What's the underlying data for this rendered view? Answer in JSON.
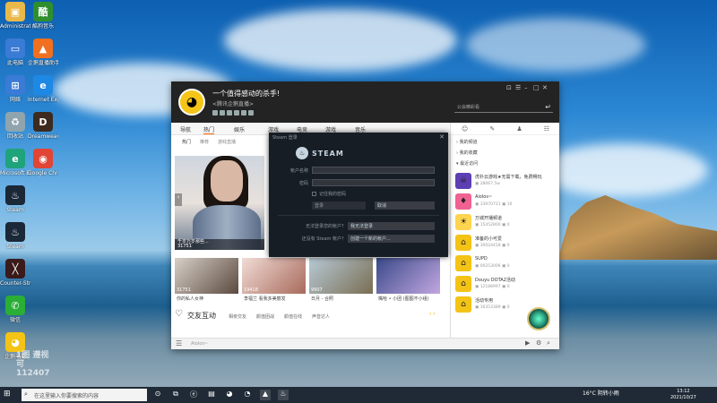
{
  "desktop": {
    "icons": [
      {
        "label": "Administrator",
        "icon": "user-folder-icon",
        "color": "#e8b84a",
        "glyph": "▣"
      },
      {
        "label": "酷狗音乐",
        "icon": "kugou-icon",
        "color": "#2f8f2f",
        "glyph": "酷"
      },
      {
        "label": "此电脑",
        "icon": "computer-icon",
        "color": "#3a7bd5",
        "glyph": "▭"
      },
      {
        "label": "企鹅直播助手",
        "icon": "live-assistant-icon",
        "color": "#f07020",
        "glyph": "▲"
      },
      {
        "label": "网络",
        "icon": "network-icon",
        "color": "#3a7bd5",
        "glyph": "⊞"
      },
      {
        "label": "Internet Explorer",
        "icon": "ie-icon",
        "color": "#1e88e5",
        "glyph": "e"
      },
      {
        "label": "回收站",
        "icon": "recycle-bin-icon",
        "color": "#90a4ae",
        "glyph": "♻"
      },
      {
        "label": "Dreamweaver Illustrator",
        "icon": "dreamweaver-icon",
        "color": "#3d2b1f",
        "glyph": "D"
      },
      {
        "label": "Microsoft Edge",
        "icon": "edge-icon",
        "color": "#1fa37a",
        "glyph": "e"
      },
      {
        "label": "Google Chrome",
        "icon": "chrome-icon",
        "color": "#e04535",
        "glyph": "◉"
      },
      {
        "label": "Steam",
        "icon": "steam-icon",
        "color": "#1b2838",
        "glyph": "♨"
      },
      {
        "label": "",
        "icon": "blank-icon",
        "color": "rgba(0,0,0,0)",
        "glyph": ""
      },
      {
        "label": "Steam",
        "icon": "steam-icon-2",
        "color": "#1b2838",
        "glyph": "♨"
      },
      {
        "label": "",
        "icon": "blank-icon-2",
        "color": "rgba(0,0,0,0)",
        "glyph": ""
      },
      {
        "label": "Counter-Strike",
        "icon": "game-icon",
        "color": "#3a1a1a",
        "glyph": "╳"
      },
      {
        "label": "",
        "icon": "blank-icon-3",
        "color": "rgba(0,0,0,0)",
        "glyph": ""
      },
      {
        "label": "微信",
        "icon": "wechat-icon",
        "color": "#2aae35",
        "glyph": "✆"
      },
      {
        "label": "",
        "icon": "blank-icon-4",
        "color": "rgba(0,0,0,0)",
        "glyph": ""
      },
      {
        "label": "企鹅电竞",
        "icon": "penguin-esports-icon",
        "color": "#f3c316",
        "glyph": "◕"
      }
    ],
    "watermark": "1图 遵视可 112407"
  },
  "app": {
    "title": "一个值得感动的杀手!",
    "subtitle": "<腾讯企鹅直播>",
    "search_placeholder": "公会精彩看",
    "window_controls": [
      "⊡",
      "☰",
      "–",
      "□",
      "✕"
    ],
    "nav": [
      "导航",
      "热门",
      "娱乐",
      "游戏",
      "电竞",
      "游戏",
      "音乐"
    ],
    "nav_active": 1,
    "subnav": [
      "热门",
      "推荐",
      "游戏直播"
    ],
    "banner": {
      "caption_top": "千岁万岁那些...",
      "caption_bottom": "31751"
    },
    "thumbs": [
      {
        "count": "31751",
        "caption": "你的私人女神",
        "color1": "#d7cfc8",
        "color2": "#5b4a3f"
      },
      {
        "count": "19418",
        "caption": "李福兰 看我多美丽发",
        "color1": "#f1dcd6",
        "color2": "#a86a5c"
      },
      {
        "count": "9907",
        "caption": "日月 - 合照",
        "color1": "#b7c9d6",
        "color2": "#7a6e52"
      },
      {
        "count": "",
        "caption": "嘴哈 • 小团 (图图不小组)",
        "color1": "#3a4a8a",
        "color2": "#c2a7e0"
      }
    ],
    "social": {
      "title": "交友互动",
      "tabs": [
        "相亲交友",
        "颜值团战",
        "颜值在线",
        "声音达人"
      ]
    },
    "footer_hint": "Aiolos~"
  },
  "rpanel": {
    "icons": [
      "☺",
      "✎",
      "♟",
      "☷"
    ],
    "sections": [
      "我的频道",
      "我的收藏",
      "最近访问"
    ],
    "items": [
      {
        "name": "虎扑云游戏★无需下载，免费畅玩",
        "stat": "28067.5w",
        "color": "#5d3fb3",
        "glyph": "☠"
      },
      {
        "name": "Aiolos~",
        "stat": "33970721",
        "stat2": "16",
        "color": "#f06292",
        "glyph": "♦"
      },
      {
        "name": "万城开播频道",
        "stat": "15452800",
        "stat2": "0",
        "color": "#ffd54f",
        "glyph": "☀"
      },
      {
        "name": "准备的小可爱",
        "stat": "30024418",
        "stat2": "0",
        "color": "#f3c316",
        "glyph": "⌂"
      },
      {
        "name": "SUPD",
        "stat": "00253006",
        "stat2": "0",
        "color": "#f3c316",
        "glyph": "⌂"
      },
      {
        "name": "Douyu DOTA2活动",
        "stat": "12188997",
        "stat2": "0",
        "color": "#f3c316",
        "glyph": "⌂"
      },
      {
        "name": "活动专用",
        "stat": "10353389",
        "stat2": "0",
        "color": "#f3c316",
        "glyph": "⌂"
      }
    ]
  },
  "steam": {
    "title": "Steam 登录",
    "logo_text": "STEAM",
    "account_label": "帐户名称",
    "password_label": "密码",
    "remember_label": "记住我的密码",
    "login_label": "登录",
    "cancel_label": "取消",
    "lost_label": "无法登录您的帐户？",
    "lost_button": "我无法登录",
    "create_label": "还没有 Steam 帐户？",
    "create_button": "创建一个新的帐户..."
  },
  "taskbar": {
    "search_placeholder": "在这里输入你要搜索的内容",
    "tray_temp": "16°C 阴转小雨",
    "clock_time": "13:12",
    "clock_date": "2021/10/27",
    "pinned": [
      "⊙",
      "⧉",
      "ⓔ",
      "▤",
      "◕",
      "◔",
      "▲",
      "♨"
    ]
  }
}
